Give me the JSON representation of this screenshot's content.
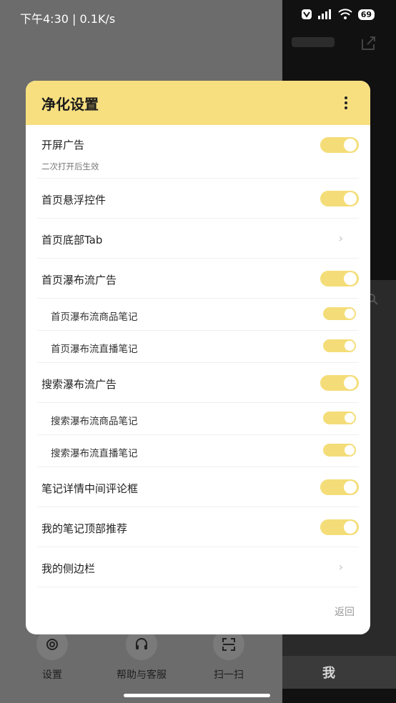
{
  "status": {
    "time_speed": "下午4:30 | 0.1K/s",
    "battery": "69"
  },
  "background": {
    "nav": [
      {
        "label": "设置",
        "icon": "gear-icon"
      },
      {
        "label": "帮助与客服",
        "icon": "headset-icon"
      },
      {
        "label": "扫一扫",
        "icon": "scan-icon"
      }
    ],
    "me_tab": "我"
  },
  "dialog": {
    "title": "净化设置",
    "back_label": "返回",
    "rows": [
      {
        "label": "开屏广告",
        "hint": "二次打开后生效",
        "control": "toggle",
        "on": true
      },
      {
        "label": "首页悬浮控件",
        "control": "toggle",
        "on": true
      },
      {
        "label": "首页底部Tab",
        "control": "chevron"
      },
      {
        "label": "首页瀑布流广告",
        "control": "toggle",
        "on": true
      },
      {
        "label": "首页瀑布流商品笔记",
        "control": "toggle",
        "on": true,
        "sub": true
      },
      {
        "label": "首页瀑布流直播笔记",
        "control": "toggle",
        "on": true,
        "sub": true
      },
      {
        "label": "搜索瀑布流广告",
        "control": "toggle",
        "on": true
      },
      {
        "label": "搜索瀑布流商品笔记",
        "control": "toggle",
        "on": true,
        "sub": true
      },
      {
        "label": "搜索瀑布流直播笔记",
        "control": "toggle",
        "on": true,
        "sub": true
      },
      {
        "label": "笔记详情中间评论框",
        "control": "toggle",
        "on": true
      },
      {
        "label": "我的笔记顶部推荐",
        "control": "toggle",
        "on": true
      },
      {
        "label": "我的侧边栏",
        "control": "chevron"
      }
    ]
  },
  "colors": {
    "header": "#f7df80",
    "toggle_on": "#f4dd78"
  }
}
